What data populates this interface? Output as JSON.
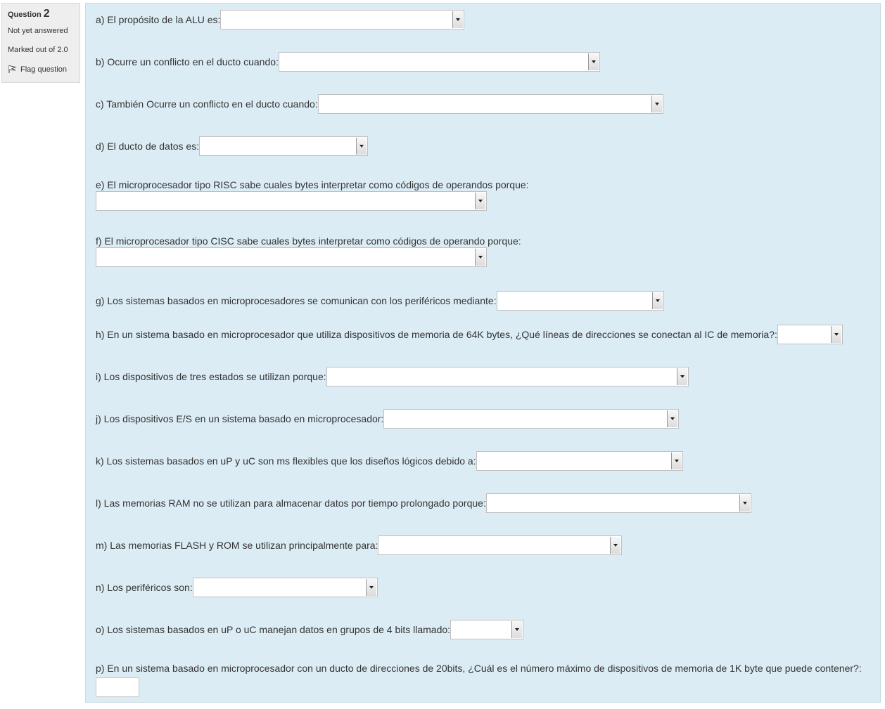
{
  "info": {
    "question_label": "Question",
    "question_number": "2",
    "state": "Not yet answered",
    "grade": "Marked out of 2.0",
    "flag_label": "Flag question"
  },
  "questions": [
    {
      "label": "a) El propósito de la ALU es:",
      "value": ""
    },
    {
      "label": "b) Ocurre un conflicto en el ducto cuando:",
      "value": ""
    },
    {
      "label": "c) También Ocurre un conflicto en el ducto cuando:",
      "value": ""
    },
    {
      "label": "d) El ducto de datos es:",
      "value": ""
    },
    {
      "label": "e) El microprocesador tipo RISC sabe cuales bytes interpretar como códigos de operandos porque:",
      "value": ""
    },
    {
      "label": "f) El microprocesador tipo CISC sabe cuales bytes interpretar como códigos de operando porque:",
      "value": ""
    },
    {
      "label": "g) Los sistemas basados en microprocesadores se comunican con los periféricos mediante:",
      "value": ""
    },
    {
      "label": "h) En un sistema basado en microprocesador que utiliza dispositivos de memoria de 64K bytes, ¿Qué líneas de direcciones se conectan al IC de memoria?:",
      "value": ""
    },
    {
      "label": "i) Los dispositivos de tres estados se utilizan porque:",
      "value": ""
    },
    {
      "label": "j) Los dispositivos E/S en un sistema basado en microprocesador:",
      "value": ""
    },
    {
      "label": "k) Los sistemas basados en uP y uC son ms flexibles que los diseños lógicos debido a:",
      "value": ""
    },
    {
      "label": "l) Las memorias RAM no se utilizan para almacenar datos por tiempo prolongado porque:",
      "value": ""
    },
    {
      "label": "m) Las memorias FLASH y ROM se utilizan principalmente para:",
      "value": ""
    },
    {
      "label": "n) Los periféricos son:",
      "value": ""
    },
    {
      "label": "o) Los sistemas basados en uP o uC manejan datos en grupos de 4 bits llamado:",
      "value": ""
    },
    {
      "label": "p) En un sistema basado en microprocesador con un ducto de direcciones de 20bits, ¿Cuál es el número máximo de dispositivos de memoria de 1K byte que puede contener?:",
      "value": ""
    }
  ]
}
